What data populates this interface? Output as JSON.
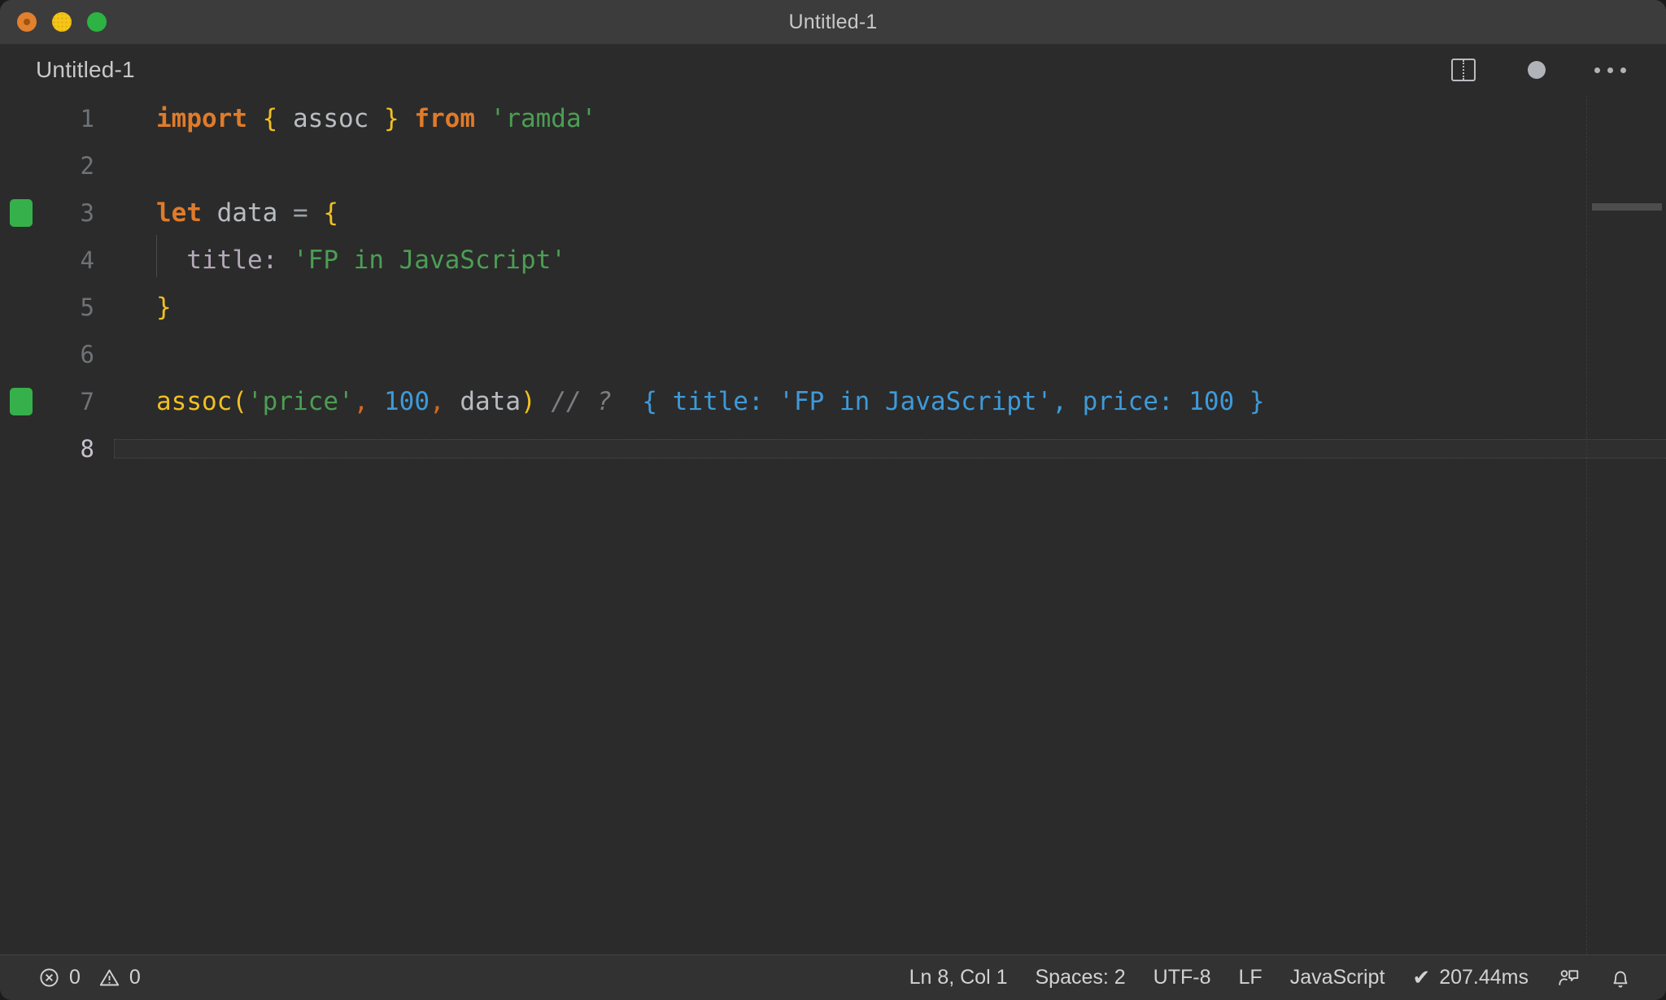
{
  "window": {
    "title": "Untitled-1",
    "traffic_lights": [
      "close-button",
      "minimize-button",
      "maximize-button"
    ]
  },
  "tab": {
    "label": "Untitled-1",
    "actions": [
      {
        "name": "split-editor-icon",
        "label": "Split Editor Right"
      },
      {
        "name": "unsaved-indicator-icon",
        "label": "Unsaved changes"
      },
      {
        "name": "more-actions-icon",
        "label": "More Actions..."
      }
    ]
  },
  "editor": {
    "language": "JavaScript",
    "lines": [
      {
        "number": "1",
        "marker": false,
        "active": false,
        "tokens": [
          {
            "t": "import",
            "c": "kw"
          },
          {
            "t": " ",
            "c": "plain"
          },
          {
            "t": "{",
            "c": "brace"
          },
          {
            "t": " assoc ",
            "c": "plain"
          },
          {
            "t": "}",
            "c": "brace"
          },
          {
            "t": " ",
            "c": "plain"
          },
          {
            "t": "from",
            "c": "kw"
          },
          {
            "t": " ",
            "c": "plain"
          },
          {
            "t": "'ramda'",
            "c": "str"
          }
        ]
      },
      {
        "number": "2",
        "marker": false,
        "active": false,
        "tokens": []
      },
      {
        "number": "3",
        "marker": true,
        "active": false,
        "tokens": [
          {
            "t": "let",
            "c": "kw"
          },
          {
            "t": " ",
            "c": "plain"
          },
          {
            "t": "data",
            "c": "plain"
          },
          {
            "t": " ",
            "c": "plain"
          },
          {
            "t": "=",
            "c": "op"
          },
          {
            "t": " ",
            "c": "plain"
          },
          {
            "t": "{",
            "c": "brace"
          }
        ]
      },
      {
        "number": "4",
        "marker": false,
        "active": false,
        "indent_guide": true,
        "tokens": [
          {
            "t": "  ",
            "c": "plain"
          },
          {
            "t": "title",
            "c": "prop"
          },
          {
            "t": ":",
            "c": "prop"
          },
          {
            "t": " ",
            "c": "plain"
          },
          {
            "t": "'FP in JavaScript'",
            "c": "str"
          }
        ]
      },
      {
        "number": "5",
        "marker": false,
        "active": false,
        "tokens": [
          {
            "t": "}",
            "c": "brace"
          }
        ]
      },
      {
        "number": "6",
        "marker": false,
        "active": false,
        "tokens": []
      },
      {
        "number": "7",
        "marker": true,
        "active": false,
        "tokens": [
          {
            "t": "assoc",
            "c": "fn"
          },
          {
            "t": "(",
            "c": "brace"
          },
          {
            "t": "'price'",
            "c": "str"
          },
          {
            "t": ",",
            "c": "punct"
          },
          {
            "t": " ",
            "c": "plain"
          },
          {
            "t": "100",
            "c": "num"
          },
          {
            "t": ",",
            "c": "punct"
          },
          {
            "t": " ",
            "c": "plain"
          },
          {
            "t": "data",
            "c": "plain"
          },
          {
            "t": ")",
            "c": "brace"
          },
          {
            "t": " ",
            "c": "plain"
          },
          {
            "t": "// ?",
            "c": "comment"
          },
          {
            "t": "  ",
            "c": "plain"
          },
          {
            "t": "{ title: 'FP in JavaScript', price: 100 }",
            "c": "result"
          }
        ]
      },
      {
        "number": "8",
        "marker": false,
        "active": true,
        "tokens": []
      }
    ]
  },
  "statusbar": {
    "errors_icon": "error-circle-icon",
    "errors": "0",
    "warnings_icon": "warning-triangle-icon",
    "warnings": "0",
    "cursor": "Ln 8, Col 1",
    "indentation": "Spaces: 2",
    "encoding": "UTF-8",
    "eol": "LF",
    "language": "JavaScript",
    "runtime_check": "✔",
    "runtime": "207.44ms",
    "feedback_icon": "feedback-person-icon",
    "bell_icon": "notifications-bell-icon"
  }
}
